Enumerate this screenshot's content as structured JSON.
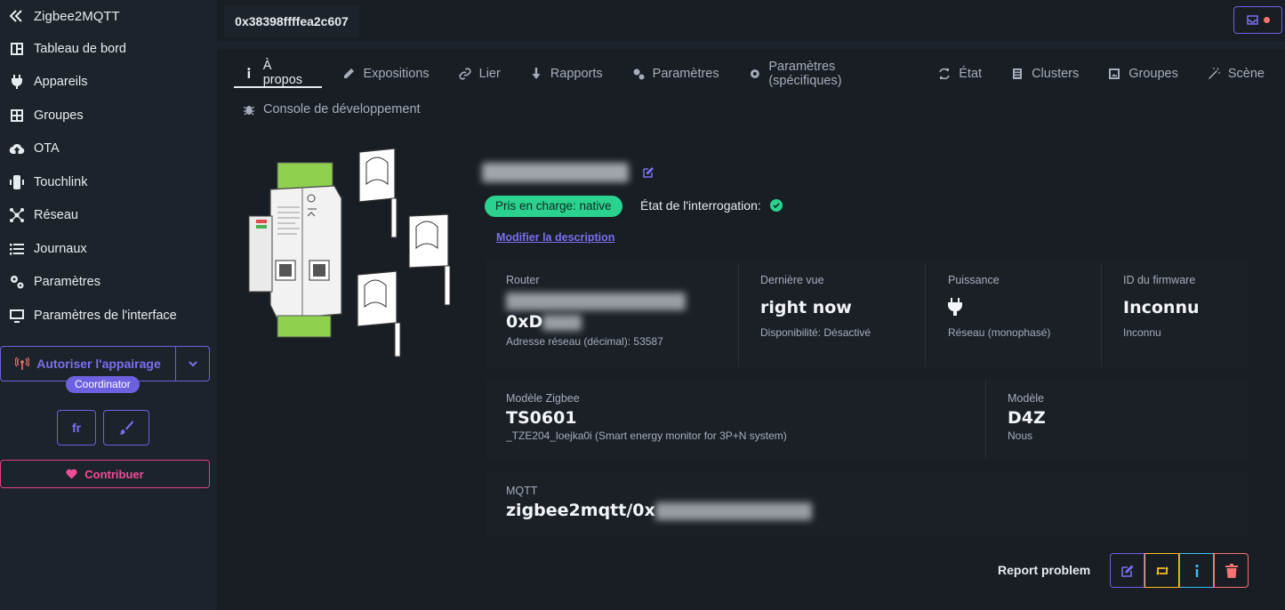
{
  "sidebar": {
    "brand": "Zigbee2MQTT",
    "items": [
      {
        "label": "Tableau de bord",
        "icon": "dashboard-icon"
      },
      {
        "label": "Appareils",
        "icon": "plug-icon"
      },
      {
        "label": "Groupes",
        "icon": "groups-icon"
      },
      {
        "label": "OTA",
        "icon": "cloud-upload-icon"
      },
      {
        "label": "Touchlink",
        "icon": "touchlink-icon"
      },
      {
        "label": "Réseau",
        "icon": "network-icon"
      },
      {
        "label": "Journaux",
        "icon": "list-icon"
      },
      {
        "label": "Paramètres",
        "icon": "gears-icon"
      },
      {
        "label": "Paramètres de l'interface",
        "icon": "monitor-icon"
      }
    ],
    "permit_join_label": "Autoriser l'appairage",
    "coordinator_badge": "Coordinator",
    "language": "fr",
    "contribute_label": "Contribuer"
  },
  "header": {
    "device_address": "0x38398ffffea2c607"
  },
  "tabs": [
    {
      "label": "À propos",
      "icon": "info-icon",
      "active": true
    },
    {
      "label": "Expositions",
      "icon": "pencil-icon"
    },
    {
      "label": "Lier",
      "icon": "link-icon"
    },
    {
      "label": "Rapports",
      "icon": "download-icon"
    },
    {
      "label": "Paramètres",
      "icon": "gears-icon"
    },
    {
      "label": "Paramètres (spécifiques)",
      "icon": "gear-icon"
    },
    {
      "label": "État",
      "icon": "refresh-icon"
    },
    {
      "label": "Clusters",
      "icon": "document-icon"
    },
    {
      "label": "Groupes",
      "icon": "image-icon"
    },
    {
      "label": "Scène",
      "icon": "wand-icon"
    },
    {
      "label": "Console de développement",
      "icon": "bug-icon"
    }
  ],
  "device": {
    "supported_badge": "Pris en charge: native",
    "interview_label": "État de l'interrogation:",
    "modify_description": "Modifier la description",
    "stats": {
      "router_title": "Router",
      "router_value_prefix": "0xD",
      "router_desc": "Adresse réseau (décimal): 53587",
      "last_seen_title": "Dernière vue",
      "last_seen_value": "right now",
      "last_seen_desc": "Disponibilité: Désactivé",
      "power_title": "Puissance",
      "power_desc": "Réseau (monophasé)",
      "firmware_title": "ID du firmware",
      "firmware_value": "Inconnu",
      "firmware_desc": "Inconnu",
      "zigbee_model_title": "Modèle Zigbee",
      "zigbee_model_value": "TS0601",
      "zigbee_model_desc": "_TZE204_loejka0i (Smart energy monitor for 3P+N system)",
      "model_title": "Modèle",
      "model_value": "D4Z",
      "model_desc": "Nous",
      "mqtt_title": "MQTT",
      "mqtt_value_prefix": "zigbee2mqtt/0x"
    }
  },
  "actions": {
    "report_problem": "Report problem"
  },
  "colors": {
    "primary": "#6e61e0",
    "success": "#2ad28e",
    "warning": "#fbbd23",
    "info": "#3abff8",
    "error": "#f87272",
    "pink": "#e0408a"
  }
}
